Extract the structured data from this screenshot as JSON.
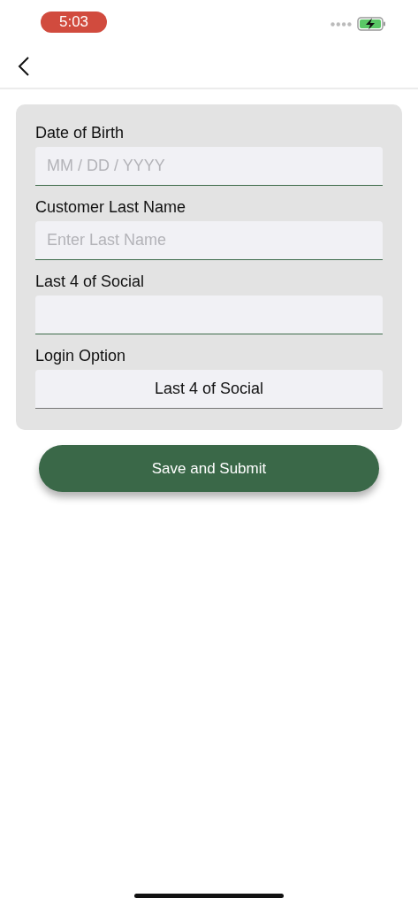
{
  "status_bar": {
    "time": "5:03"
  },
  "form": {
    "fields": [
      {
        "kind": "input",
        "label": "Date of Birth",
        "placeholder": "MM / DD / YYYY"
      },
      {
        "kind": "input",
        "label": "Customer Last Name",
        "placeholder": "Enter Last Name"
      },
      {
        "kind": "input",
        "label": "Last 4 of Social"
      },
      {
        "kind": "select",
        "label": "Login Option",
        "value": "Last 4 of Social"
      }
    ]
  },
  "submit_button": {
    "label": "Save and Submit"
  }
}
